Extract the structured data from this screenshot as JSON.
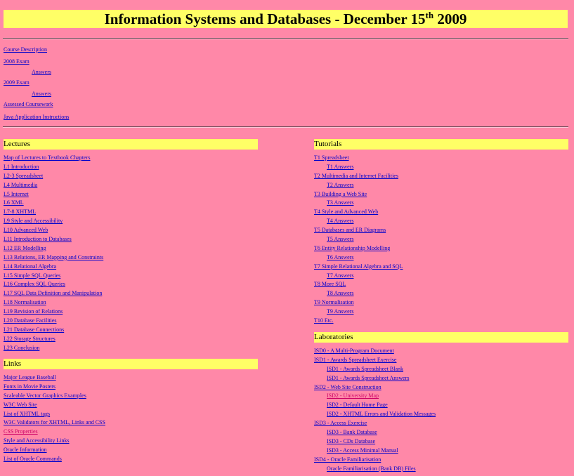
{
  "page": {
    "title_main": "Information Systems and Databases - December 15",
    "title_sup": "th",
    "title_year": " 2009"
  },
  "top_links": [
    {
      "label": "Course Description",
      "indent": false
    },
    {
      "label": "2008 Exam",
      "indent": false
    },
    {
      "label": "Answers",
      "indent": true
    },
    {
      "label": "2009 Exam",
      "indent": false
    },
    {
      "label": "Answers",
      "indent": true
    },
    {
      "label": "Assessed Coursework",
      "indent": false
    },
    {
      "label": "Java Application Instructions",
      "indent": false
    }
  ],
  "lectures": {
    "heading": "Lectures",
    "items": [
      "Map of Lectures to Textbook Chapters",
      "L1 Introduction",
      "L2-3 Spreadsheet",
      "L4 Multimedia",
      "L5 Internet",
      "L6 XML",
      "L7-8 XHTML",
      "L9 Style and Accessibility",
      "L10 Advanced Web",
      "L11 Introduction to Databases",
      "L12 ER Modelling",
      "L13 Relations, ER Mapping and Constraints",
      "L14 Relational Algebra",
      "L15 Simple SQL Queries",
      "L16 Complex SQL Queries",
      "L17 SQL Data Definition and Manipulation",
      "L18 Normalisation",
      "L19 Revision of Relations",
      "L20 Database Facilities",
      "L21 Database Connections",
      "L22 Storage Structures",
      "L23 Conclusion"
    ]
  },
  "links": {
    "heading": "Links",
    "items": [
      {
        "label": "Major League Baseball",
        "visited": false
      },
      {
        "label": "Fonts in Movie Posters",
        "visited": false
      },
      {
        "label": "Scaleable Vector Graphics Examples",
        "visited": false
      },
      {
        "label": "W3C Web Site",
        "visited": false
      },
      {
        "label": "List of XHTML tags",
        "visited": false
      },
      {
        "label": "W3C Validators for XHTML, Links and CSS",
        "visited": false
      },
      {
        "label": "CSS Properties",
        "visited": true
      },
      {
        "label": "Style and Accessibility Links",
        "visited": false
      },
      {
        "label": "Oracle Information",
        "visited": false
      },
      {
        "label": "List of Oracle Commands",
        "visited": false
      }
    ]
  },
  "tutorials": {
    "heading": "Tutorials",
    "items": [
      {
        "label": "T1 Spreadsheet",
        "indent": false
      },
      {
        "label": "T1 Answers",
        "indent": true
      },
      {
        "label": "T2 Multimedia and Internet Facilities",
        "indent": false
      },
      {
        "label": "T2 Answers",
        "indent": true
      },
      {
        "label": "T3 Building a Web Site",
        "indent": false
      },
      {
        "label": "T3 Answers",
        "indent": true
      },
      {
        "label": "T4 Style and Advanced Web",
        "indent": false
      },
      {
        "label": "T4 Answers",
        "indent": true
      },
      {
        "label": "T5 Databases and ER Diagrams",
        "indent": false
      },
      {
        "label": "T5 Answers",
        "indent": true
      },
      {
        "label": "T6 Entity Relationship Modelling",
        "indent": false
      },
      {
        "label": "T6 Answers",
        "indent": true
      },
      {
        "label": "T7 Simple Relational Algebra and SQL",
        "indent": false
      },
      {
        "label": "T7 Answers",
        "indent": true
      },
      {
        "label": "T8 More SQL",
        "indent": false
      },
      {
        "label": "T8 Answers",
        "indent": true
      },
      {
        "label": "T9 Normalisation",
        "indent": false
      },
      {
        "label": "T9 Answers",
        "indent": true
      },
      {
        "label": "T10 Etc.",
        "indent": false
      }
    ]
  },
  "laboratories": {
    "heading": "Laboratories",
    "items": [
      {
        "label": "ISD0 - A Multi-Program Document",
        "indent": false,
        "visited": false
      },
      {
        "label": "ISD1 - Awards Spreadsheet Exercise",
        "indent": false,
        "visited": false
      },
      {
        "label": "ISD1 - Awards Spreadsheet Blank",
        "indent": true,
        "visited": false
      },
      {
        "label": "ISD1 - Awards Spreadsheet Answers",
        "indent": true,
        "visited": false
      },
      {
        "label": "ISD2 - Web Site Construction",
        "indent": false,
        "visited": false
      },
      {
        "label": "ISD2 - University Map",
        "indent": true,
        "visited": true
      },
      {
        "label": "ISD2 - Default Home Page",
        "indent": true,
        "visited": false
      },
      {
        "label": "ISD2 - XHTML Errors and Validation Messages",
        "indent": true,
        "visited": false
      },
      {
        "label": "ISD3 - Access Exercise",
        "indent": false,
        "visited": false
      },
      {
        "label": "ISD3 - Bank Database",
        "indent": true,
        "visited": false
      },
      {
        "label": "ISD3 - CDs Database",
        "indent": true,
        "visited": false
      },
      {
        "label": "ISD3 - Access Minimal Manual",
        "indent": true,
        "visited": false
      },
      {
        "label": "ISD4 - Oracle Familiarisation",
        "indent": false,
        "visited": false
      },
      {
        "label": "Oracle Familiarisation (Bank DB) Files",
        "indent": true,
        "visited": false
      }
    ]
  }
}
